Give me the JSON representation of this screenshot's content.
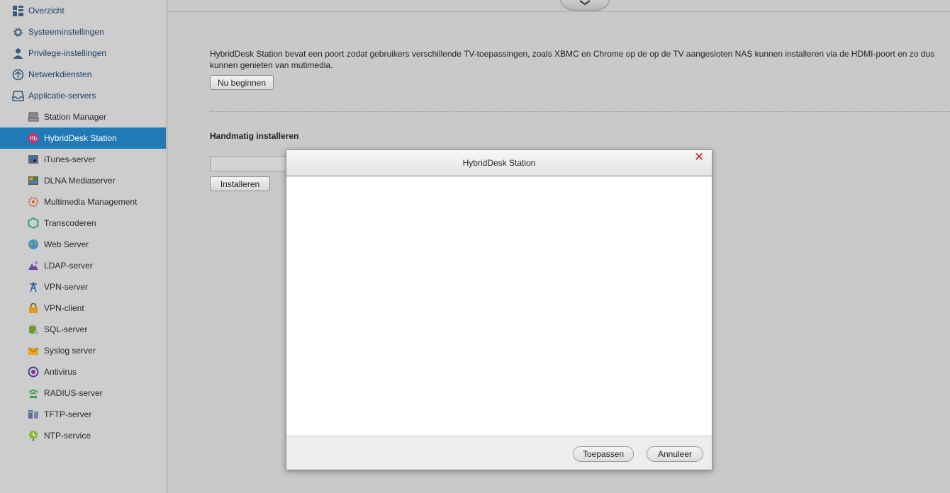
{
  "sidebar": {
    "top_items": [
      {
        "label": "Overzicht",
        "icon": "grid-icon"
      },
      {
        "label": "Systeeminstellingen",
        "icon": "gear-icon"
      },
      {
        "label": "Privilege-instellingen",
        "icon": "user-icon"
      },
      {
        "label": "Netwerkdiensten",
        "icon": "network-icon"
      },
      {
        "label": "Applicatie-servers",
        "icon": "inbox-icon"
      }
    ],
    "sub_items": [
      {
        "label": "Station Manager",
        "icon": "station-manager-icon"
      },
      {
        "label": "HybridDesk Station",
        "icon": "hybriddesk-icon",
        "selected": true
      },
      {
        "label": "iTunes-server",
        "icon": "itunes-icon"
      },
      {
        "label": "DLNA Mediaserver",
        "icon": "dlna-icon"
      },
      {
        "label": "Multimedia Management",
        "icon": "multimedia-icon"
      },
      {
        "label": "Transcoderen",
        "icon": "transcode-icon"
      },
      {
        "label": "Web Server",
        "icon": "globe-icon"
      },
      {
        "label": "LDAP-server",
        "icon": "ldap-icon"
      },
      {
        "label": "VPN-server",
        "icon": "antenna-icon"
      },
      {
        "label": "VPN-client",
        "icon": "lock-icon"
      },
      {
        "label": "SQL-server",
        "icon": "database-icon"
      },
      {
        "label": "Syslog server",
        "icon": "envelope-icon"
      },
      {
        "label": "Antivirus",
        "icon": "antivirus-icon"
      },
      {
        "label": "RADIUS-server",
        "icon": "wifi-icon"
      },
      {
        "label": "TFTP-server",
        "icon": "tftp-icon"
      },
      {
        "label": "NTP-service",
        "icon": "clock-icon"
      }
    ]
  },
  "main": {
    "intro_text": "HybridDesk Station bevat een poort zodat gebruikers verschillende TV-toepassingen, zoals XBMC en Chrome op de op de TV aangesloten NAS kunnen installeren via de HDMI-poort en zo dus kunnen genieten van mutimedia.",
    "start_button": "Nu beginnen",
    "manual_title": "Handmatig installeren",
    "install_button": "Installeren"
  },
  "modal": {
    "title": "HybridDesk Station",
    "apply_button": "Toepassen",
    "cancel_button": "Annuleer"
  },
  "colors": {
    "selected_bg": "#1f7ab5",
    "close_red": "#d32020",
    "nav_text": "#1f3f66"
  }
}
